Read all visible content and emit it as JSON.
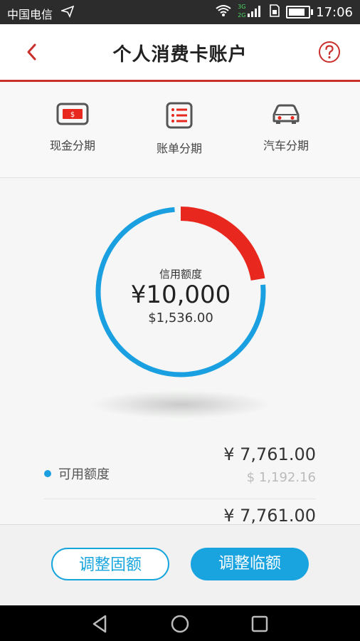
{
  "status_bar": {
    "carrier": "中国电信",
    "network_top": "3G",
    "network_bottom": "2G",
    "time": "17:06"
  },
  "header": {
    "title": "个人消费卡账户"
  },
  "quick_actions": [
    {
      "label": "现金分期",
      "icon": "cash-icon"
    },
    {
      "label": "账单分期",
      "icon": "bill-icon"
    },
    {
      "label": "汽车分期",
      "icon": "car-icon"
    }
  ],
  "credit": {
    "label": "信用额度",
    "value": "¥10,000",
    "usd": "$1,536.00",
    "used_fraction": 0.224,
    "colors": {
      "available": "#1aa0e0",
      "used": "#e8281f"
    }
  },
  "details": [
    {
      "label": "可用额度",
      "amount": "¥  7,761.00",
      "sub": "$  1,192.16"
    },
    {
      "amount": "¥  7,761.00"
    }
  ],
  "actions": {
    "fixed_label": "调整固额",
    "temp_label": "调整临额"
  }
}
